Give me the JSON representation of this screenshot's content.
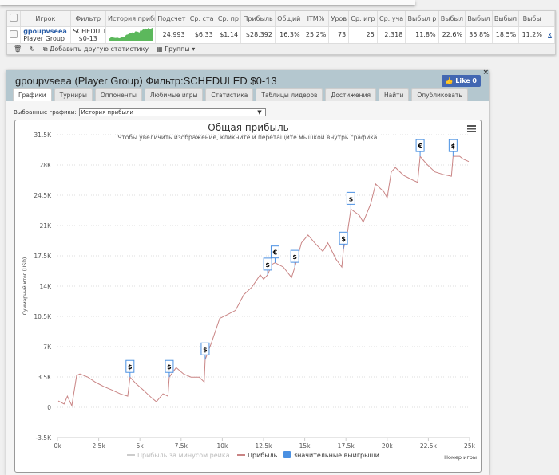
{
  "grid": {
    "headers": [
      "Игрок",
      "Фильтр",
      "История прибы",
      "Подсчет",
      "Ср. ста",
      "Ср. пр",
      "Прибыль",
      "Общий",
      "ITM%",
      "Уров",
      "Ср. игр",
      "Ср. уча",
      "Выбыл р",
      "Выбыл",
      "Выбыл",
      "Выбыл",
      "Выбы"
    ],
    "row": {
      "player": "gpoupvseea",
      "group": "Player Group",
      "filter1": "SCHEDULEI",
      "filter2": "$0-13",
      "values": [
        "24,993",
        "$6.33",
        "$1.14",
        "$28,392",
        "16.3%",
        "25.2%",
        "73",
        "25",
        "2,318",
        "11.8%",
        "22.6%",
        "35.8%",
        "18.5%",
        "11.2%"
      ],
      "remove": "x"
    },
    "toolbar": {
      "add": "Добавить другую статистику",
      "groups": "Группы"
    }
  },
  "panel": {
    "title": "gpoupvseea (Player Group) Фильтр:SCHEDULED $0-13",
    "like": "Like 0",
    "close": "×",
    "tabs": [
      "Графики",
      "Турниры",
      "Оппоненты",
      "Любимые игры",
      "Статистика",
      "Таблицы лидеров",
      "Достижения",
      "Найти",
      "Опубликовать"
    ],
    "selected_label": "Выбранные графики:",
    "selected_value": "История прибыли"
  },
  "colors": {
    "line": "#c98484",
    "marker": "#4a90e2",
    "sparkline": "#5cb85c"
  },
  "chart_data": {
    "type": "line",
    "title": "Общая прибыль",
    "subtitle": "Чтобы увеличить изображение, кликните и перетащите мышкой внутрь графика.",
    "ylabel": "Суммарный итог (USD)",
    "xlabel": "Номер игры",
    "xlim": [
      0,
      25000
    ],
    "ylim": [
      -3500,
      31500
    ],
    "grid": true,
    "legend": "bottom",
    "yticks": [
      "-3.5K",
      "0",
      "3.5K",
      "7K",
      "10.5K",
      "14K",
      "17.5K",
      "21K",
      "24.5K",
      "28K",
      "31.5K"
    ],
    "xticks": [
      "0k",
      "2.5k",
      "5k",
      "7.5k",
      "10k",
      "12.5k",
      "15k",
      "17.5k",
      "20k",
      "22.5k",
      "25k"
    ],
    "legend_items": [
      "Прибыль за минусом рейка",
      "Прибыль",
      "Значительные выигрыши"
    ],
    "series": [
      {
        "name": "Прибыль",
        "x": [
          50,
          400,
          600,
          870,
          1160,
          1360,
          1840,
          2300,
          2800,
          3300,
          3800,
          4260,
          4400,
          4750,
          5200,
          5700,
          6000,
          6400,
          6700,
          6780,
          7200,
          7650,
          8100,
          8600,
          8900,
          8960,
          9350,
          9840,
          10300,
          10800,
          11300,
          11800,
          12300,
          12500,
          12750,
          13000,
          13200,
          13700,
          14200,
          14400,
          14800,
          15200,
          15600,
          16100,
          16400,
          16900,
          17250,
          17350,
          17600,
          17800,
          18300,
          18550,
          19000,
          19300,
          19800,
          20000,
          20250,
          20500,
          21000,
          21500,
          21850,
          22000,
          22400,
          22900,
          23400,
          23900,
          24000,
          24400,
          24600,
          24950
        ],
        "y": [
          730,
          370,
          1280,
          180,
          3660,
          3850,
          3480,
          2900,
          2400,
          2000,
          1560,
          1280,
          3480,
          2750,
          2000,
          1100,
          640,
          1560,
          1280,
          3480,
          4580,
          3850,
          3480,
          3480,
          2930,
          5500,
          7500,
          10260,
          10700,
          11200,
          13000,
          13900,
          15300,
          14800,
          15300,
          16500,
          16700,
          16200,
          15000,
          16200,
          19000,
          19900,
          19000,
          18000,
          19000,
          17100,
          16200,
          18300,
          20300,
          22900,
          22200,
          21400,
          23500,
          25800,
          24900,
          24200,
          27200,
          27700,
          26800,
          26300,
          26000,
          29000,
          28100,
          27200,
          26900,
          26700,
          29000,
          29000,
          28700,
          28400
        ]
      }
    ],
    "markers": [
      {
        "x": 4400,
        "y": 3480,
        "symbol": "$"
      },
      {
        "x": 6780,
        "y": 3480,
        "symbol": "$"
      },
      {
        "x": 8960,
        "y": 5500,
        "symbol": "$"
      },
      {
        "x": 12750,
        "y": 15300,
        "symbol": "$"
      },
      {
        "x": 13200,
        "y": 16700,
        "symbol": "€"
      },
      {
        "x": 14400,
        "y": 16200,
        "symbol": "$"
      },
      {
        "x": 17350,
        "y": 18300,
        "symbol": "$"
      },
      {
        "x": 17800,
        "y": 22900,
        "symbol": "$"
      },
      {
        "x": 22000,
        "y": 29000,
        "symbol": "€"
      },
      {
        "x": 24000,
        "y": 29000,
        "symbol": "$"
      }
    ]
  }
}
